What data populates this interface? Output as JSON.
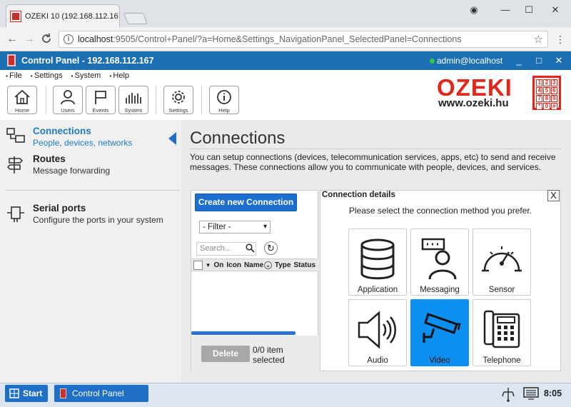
{
  "browser": {
    "tab_title": "OZEKI 10 (192.168.112.16",
    "tab_close": "×",
    "url_host": "localhost",
    "url_path": ":9505/Control+Panel/?a=Home&Settings_NavigationPanel_SelectedPanel=Connections",
    "window_buttons": {
      "profile": "◉",
      "minimize": "—",
      "maximize": "☐",
      "close": "✕"
    },
    "nav": {
      "back": "←",
      "forward": "→",
      "reload": "C",
      "star": "☆",
      "menu": "⋮"
    }
  },
  "app": {
    "header_title": "Control Panel - 192.168.112.167",
    "user": "admin@localhost",
    "header_buttons": {
      "minimize": "_",
      "maximize": "□",
      "close": "✕"
    },
    "menu": [
      "File",
      "Settings",
      "System",
      "Help"
    ],
    "toolbar": [
      {
        "label": "Home",
        "icon": "home-icon"
      },
      {
        "label": "Users",
        "icon": "user-icon"
      },
      {
        "label": "Events",
        "icon": "flag-icon"
      },
      {
        "label": "System",
        "icon": "bars-icon"
      },
      {
        "label": "Settings",
        "icon": "gear-icon"
      },
      {
        "label": "Help",
        "icon": "info-icon"
      }
    ],
    "logo": {
      "word": "OZEKI",
      "site": "www.ozeki.hu",
      "keypad": [
        "1",
        "2",
        "3",
        "4",
        "5",
        "6",
        "7",
        "8",
        "9",
        "*",
        "0",
        "#"
      ]
    }
  },
  "sidebar": {
    "items": [
      {
        "title": "Connections",
        "desc": "People, devices, networks",
        "active": true
      },
      {
        "title": "Routes",
        "desc": "Message forwarding"
      },
      {
        "title": "Serial ports",
        "desc": "Configure the ports in your system"
      }
    ]
  },
  "main": {
    "title": "Connections",
    "description": "You can setup connections (devices, telecommunication services, apps, etc) to send and receive messages. These connections allow you to communicate with people, devices, and services.",
    "create_button": "Create new Connection",
    "filter": "- Filter -",
    "search_placeholder": "Search...",
    "table_headers": [
      "On",
      "Icon",
      "Name",
      "Type",
      "Status"
    ],
    "delete_button": "Delete",
    "selection_count": "0/0 item selected"
  },
  "details": {
    "title": "Connection details",
    "close": "X",
    "subtitle": "Please select the connection method you prefer.",
    "tiles": [
      {
        "label": "Application",
        "icon": "database-icon"
      },
      {
        "label": "Messaging",
        "icon": "messaging-icon"
      },
      {
        "label": "Sensor",
        "icon": "gauge-icon"
      },
      {
        "label": "Audio",
        "icon": "speaker-icon"
      },
      {
        "label": "Video",
        "icon": "camera-icon",
        "selected": true
      },
      {
        "label": "Telephone",
        "icon": "telephone-icon"
      }
    ]
  },
  "taskbar": {
    "start": "Start",
    "control_panel": "Control Panel",
    "clock": "8:05"
  },
  "colors": {
    "accent": "#1c6fb2",
    "selected_tile": "#0b8ff0",
    "logo_red": "#e3261b"
  }
}
